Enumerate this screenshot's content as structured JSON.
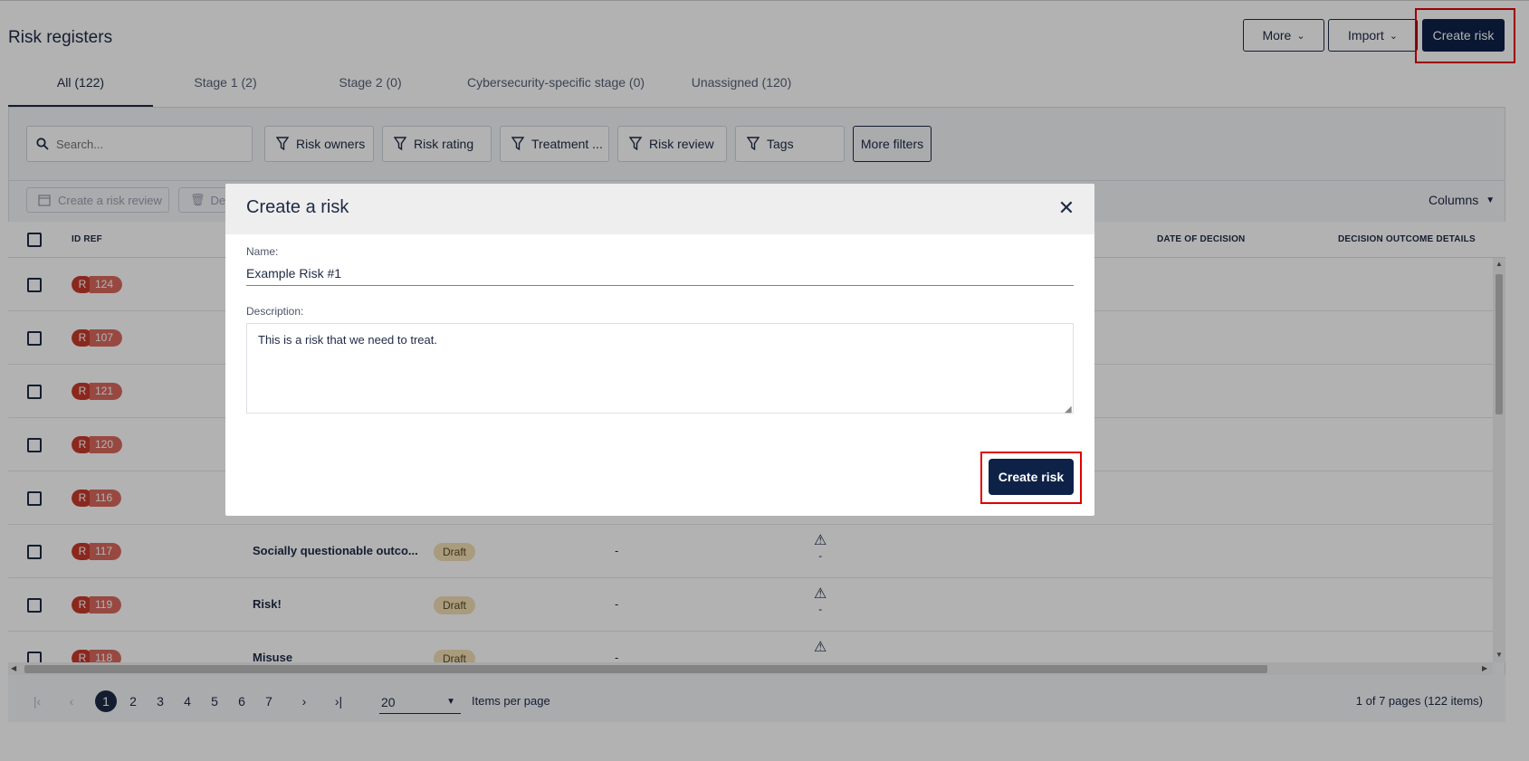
{
  "header": {
    "title": "Risk registers",
    "more_label": "More",
    "import_label": "Import",
    "create_label": "Create risk"
  },
  "tabs": [
    {
      "label": "All (122)"
    },
    {
      "label": "Stage 1 (2)"
    },
    {
      "label": "Stage 2 (0)"
    },
    {
      "label": "Cybersecurity-specific stage (0)"
    },
    {
      "label": "Unassigned (120)"
    }
  ],
  "search": {
    "placeholder": "Search..."
  },
  "filters": [
    "Risk owners",
    "Risk rating",
    "Treatment ...",
    "Risk review",
    "Tags"
  ],
  "more_filters_label": "More filters",
  "toolbar": {
    "create_review_label": "Create a risk review",
    "delete_label": "Del",
    "columns_label": "Columns"
  },
  "table": {
    "headers": {
      "id_ref": "ID REF",
      "date_of_decision": "DATE OF DECISION",
      "decision_outcome": "DECISION OUTCOME DETAILS"
    },
    "badge_prefix": "R",
    "rows": [
      {
        "id": "124"
      },
      {
        "id": "107"
      },
      {
        "id": "121"
      },
      {
        "id": "120"
      },
      {
        "id": "116"
      },
      {
        "id": "117",
        "name": "Socially questionable outco...",
        "status": "Draft",
        "col": "-",
        "rating": "-"
      },
      {
        "id": "119",
        "name": "Risk!",
        "status": "Draft",
        "col": "-",
        "rating": "-"
      },
      {
        "id": "118",
        "name": "Misuse",
        "status": "Draft",
        "col": "-",
        "rating": "-"
      }
    ]
  },
  "pagination": {
    "pages": [
      "1",
      "2",
      "3",
      "4",
      "5",
      "6",
      "7"
    ],
    "per_page": "20",
    "per_page_label": "Items per page",
    "info": "1 of 7 pages (122 items)"
  },
  "modal": {
    "title": "Create a risk",
    "name_label": "Name:",
    "name_value": "Example Risk #1",
    "description_label": "Description:",
    "description_value": "This is a risk that we need to treat.",
    "submit_label": "Create risk"
  }
}
